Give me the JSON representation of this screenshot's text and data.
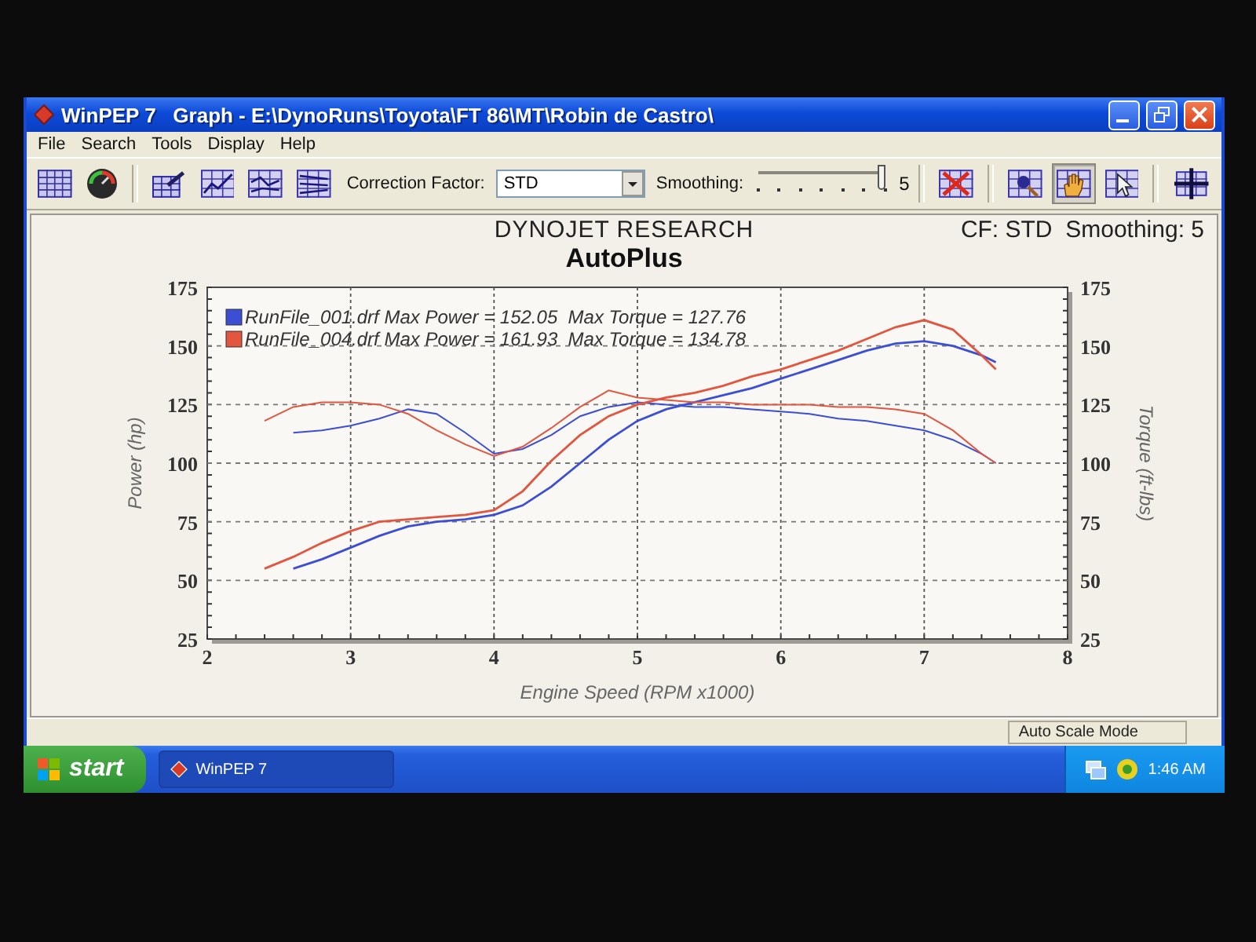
{
  "window": {
    "title": "WinPEP 7   Graph - E:\\DynoRuns\\Toyota\\FT 86\\MT\\Robin de Castro\\"
  },
  "menu": [
    "File",
    "Search",
    "Tools",
    "Display",
    "Help"
  ],
  "toolbar": {
    "correction_label": "Correction Factor:",
    "correction_value": "STD",
    "smoothing_label": "Smoothing:",
    "smoothing": {
      "level": 1.0,
      "reading": "5"
    },
    "mode_buttons": [
      {
        "selected": false
      },
      {
        "selected": true
      },
      {
        "selected": false
      }
    ]
  },
  "panel": {
    "company": "DYNOJET RESEARCH",
    "settings": "CF: STD  Smoothing: 5",
    "right_axis": {
      "label": "Torque (ft-lbs)",
      "ticks": [
        "175",
        "150",
        "125",
        "100",
        "75",
        "50",
        "25"
      ]
    },
    "chart_data": {
      "type": "line",
      "title": "AutoPlus",
      "xlabel": "Engine Speed (RPM x1000)",
      "ylabel": "Power (hp)",
      "xlim": [
        2,
        8
      ],
      "ylim": [
        25,
        175
      ],
      "xticks": [
        2,
        3,
        4,
        5,
        6,
        7,
        8
      ],
      "yticks": [
        25,
        50,
        75,
        100,
        125,
        150,
        175
      ],
      "grid": true,
      "legend": "upper left",
      "x": [
        2.4,
        2.6,
        2.8,
        3.0,
        3.2,
        3.4,
        3.6,
        3.8,
        4.0,
        4.2,
        4.4,
        4.6,
        4.8,
        5.0,
        5.2,
        5.4,
        5.6,
        5.8,
        6.0,
        6.2,
        6.4,
        6.6,
        6.8,
        7.0,
        7.2,
        7.4,
        7.5
      ],
      "series": [
        {
          "name": "RunFile_001.drf Max Power = 152.05  Max Torque = 127.76",
          "color": "#3c4fd4",
          "values": [
            null,
            55,
            59,
            64,
            69,
            73,
            75,
            76,
            78,
            82,
            90,
            100,
            110,
            118,
            123,
            126,
            129,
            132,
            136,
            140,
            144,
            148,
            151,
            152,
            150,
            146,
            143
          ]
        },
        {
          "color": "#3c4fd4",
          "values": [
            null,
            113,
            114,
            116,
            119,
            123,
            121,
            113,
            104,
            106,
            112,
            120,
            124,
            126,
            125,
            124,
            124,
            123,
            122,
            121,
            119,
            118,
            116,
            114,
            110,
            104,
            100
          ]
        },
        {
          "name": "RunFile_004.drf Max Power = 161.93  Max Torque = 134.78",
          "color": "#e2553f",
          "values": [
            55,
            60,
            66,
            71,
            75,
            76,
            77,
            78,
            80,
            88,
            101,
            112,
            120,
            125,
            128,
            130,
            133,
            137,
            140,
            144,
            148,
            153,
            158,
            161,
            157,
            146,
            140
          ]
        },
        {
          "color": "#e2553f",
          "values": [
            118,
            124,
            126,
            126,
            125,
            121,
            114,
            108,
            103,
            107,
            115,
            124,
            131,
            128,
            127,
            126,
            126,
            125,
            125,
            125,
            124,
            124,
            123,
            121,
            114,
            104,
            100
          ]
        }
      ]
    }
  },
  "status_bar": "Auto Scale Mode",
  "taskbar": {
    "start": "start",
    "tasks": [
      "WinPEP 7"
    ],
    "clock": "1:46 AM"
  }
}
